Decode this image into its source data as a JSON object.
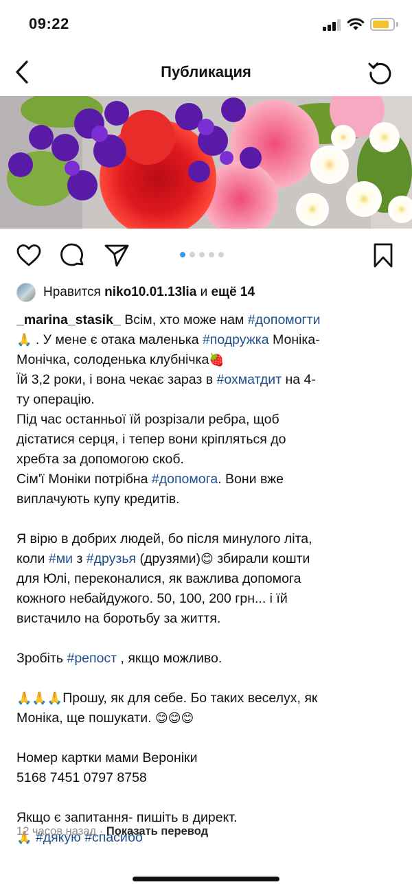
{
  "status_bar": {
    "time": "09:22",
    "battery_color": "#f2c231"
  },
  "nav": {
    "title": "Публикация",
    "back_icon": "chevron-left-icon",
    "refresh_icon": "refresh-icon"
  },
  "carousel": {
    "total": 5,
    "active": 1,
    "active_color": "#3897f0"
  },
  "likes": {
    "prefix": "Нравится",
    "user": "niko10.01.13lia",
    "conj": "и",
    "more": "ещё 14"
  },
  "caption": {
    "username": "_marina_stasik_",
    "l1_text": " Всім, хто може нам ",
    "l1_tag": "#допомогти",
    "l2_emoji": "🙏",
    "l2_text": " . У мене є отака маленька ",
    "l2_tag": "#подружка",
    "l2_end": " Моніка-",
    "l3_text": "Монічка,  солоденька клубнічка",
    "l3_emoji": "🍓",
    "l4_text": "Їй 3,2 роки, і вона чекає зараз в ",
    "l4_tag": "#охматдит",
    "l4_end": " на 4-",
    "l5": "ту операцію.",
    "l6": "Під час останньої їй розрізали ребра, щоб",
    "l7": "дістатися серця,  і тепер вони кріпляться до",
    "l8": "хребта за допомогою скоб.",
    "l9_text": "Сім'ї Моніки потрібна ",
    "l9_tag": "#допомога",
    "l9_end": ". Вони вже",
    "l10": "виплачують купу кредитів.",
    "l11": "Я вірю в добрих людей, бо після минулого літа,",
    "l12_a": "коли ",
    "l12_tag1": "#ми",
    "l12_b": " з ",
    "l12_tag2": "#друзья",
    "l12_c": " (друзями)",
    "l12_emoji": "😊",
    "l12_d": " збирали кошти",
    "l13": "для Юлі, переконалися, як важлива допомога",
    "l14": "кожного небайдужого.  50, 100, 200 грн... і їй",
    "l15": "вистачило на боротьбу за життя.",
    "l16_text": "Зробіть ",
    "l16_tag": "#репост",
    "l16_end": " ,  якщо можливо.",
    "l17_emoji": "🙏🙏🙏",
    "l17_text": "Прошу, як для себе. Бо таких веселух, як",
    "l18_text": "Моніка, ще пошукати. ",
    "l18_emoji": "😊😊😊",
    "l19": "Номер картки мами Вероніки",
    "l20": "5168 7451 0797 8758",
    "l21": "Якщо є запитання- пишіть в директ.",
    "l22_emoji": "🙏",
    "l22_tag1": "#дякую",
    "l22_tag2": "#спасибо"
  },
  "meta": {
    "time_ago": "12 часов назад",
    "separator": "·",
    "translate": "Показать перевод"
  },
  "colors": {
    "hashtag": "#1f4e8c",
    "meta_gray": "#8e8e8e"
  }
}
